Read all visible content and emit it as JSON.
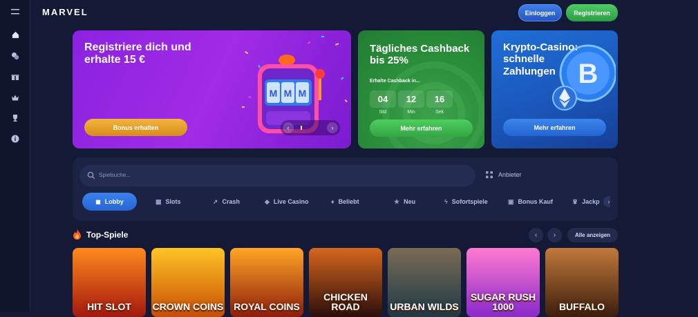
{
  "brand": {
    "logo": "MARVEL"
  },
  "sidebar": {
    "items": [
      {
        "icon": "menu-icon"
      },
      {
        "icon": "home-icon"
      },
      {
        "icon": "casino-chips-icon"
      },
      {
        "icon": "gift-icon"
      },
      {
        "icon": "crown-icon"
      },
      {
        "icon": "trophy-icon"
      },
      {
        "icon": "info-icon"
      }
    ]
  },
  "header": {
    "login_label": "Einloggen",
    "register_label": "Registrieren"
  },
  "promos": {
    "welcome": {
      "title": "Registriere dich und erhalte 15 €",
      "button": "Bonus erhalten"
    },
    "cashback": {
      "title": "Tägliches Cashback bis 25%",
      "subtitle": "Erhalte Cashback in...",
      "timer": [
        {
          "value": "04",
          "label": "Std"
        },
        {
          "value": "12",
          "label": "Min"
        },
        {
          "value": "16",
          "label": "Sek"
        }
      ],
      "button": "Mehr erfahren"
    },
    "crypto": {
      "title": "Krypto-Casino: schnelle Zahlungen",
      "button": "Mehr erfahren"
    },
    "slider": {
      "prev_icon": "chevron-left-icon",
      "next_icon": "chevron-right-icon"
    }
  },
  "search": {
    "placeholder": "Spielsuche...",
    "providers_label": "Anbieter"
  },
  "categories": [
    {
      "label": "Lobby",
      "icon": "gamepad-icon",
      "active": true
    },
    {
      "label": "Slots",
      "icon": "slots-icon",
      "active": false
    },
    {
      "label": "Crash",
      "icon": "rocket-icon",
      "active": false
    },
    {
      "label": "Live Casino",
      "icon": "dice-icon",
      "active": false
    },
    {
      "label": "Beliebt",
      "icon": "flame-icon",
      "active": false
    },
    {
      "label": "Neu",
      "icon": "star-icon",
      "active": false
    },
    {
      "label": "Sofortspiele",
      "icon": "lightning-icon",
      "active": false
    },
    {
      "label": "Bonus Kauf",
      "icon": "wallet-icon",
      "active": false
    },
    {
      "label": "Jackp",
      "icon": "crown-icon",
      "active": false
    }
  ],
  "top_games": {
    "title": "Top-Spiele",
    "show_all": "Alle anzeigen",
    "games": [
      {
        "name": "HIT SLOT",
        "color_a": "#a3180d",
        "color_b": "#ff8a1c"
      },
      {
        "name": "CROWN COINS",
        "color_a": "#c84e05",
        "color_b": "#ffc524"
      },
      {
        "name": "ROYAL COINS",
        "color_a": "#8f1d0a",
        "color_b": "#ffa626"
      },
      {
        "name": "CHICKEN ROAD",
        "color_a": "#2b0e0b",
        "color_b": "#d7661e"
      },
      {
        "name": "URBAN WILDS",
        "color_a": "#1d3a45",
        "color_b": "#7b6b55"
      },
      {
        "name": "SUGAR RUSH 1000",
        "color_a": "#8a2acb",
        "color_b": "#ff7ad0"
      },
      {
        "name": "BUFFALO",
        "color_a": "#3a1e0d",
        "color_b": "#c2793a"
      }
    ]
  }
}
